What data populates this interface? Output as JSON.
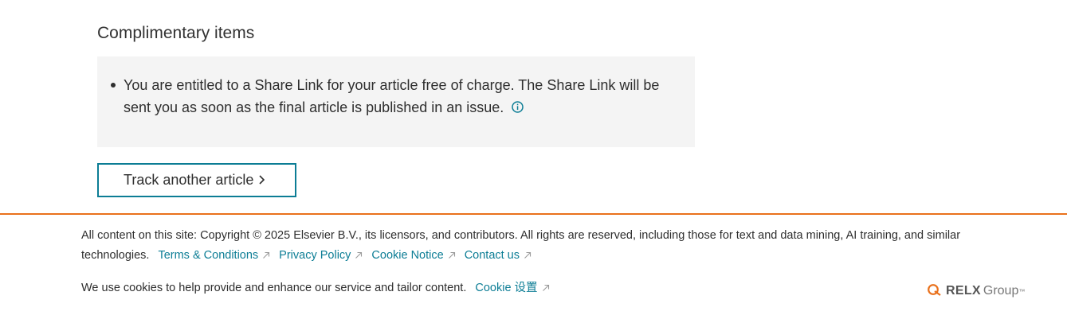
{
  "complimentary": {
    "title": "Complimentary items",
    "item_text": "You are entitled to a Share Link for your article free of charge. The Share Link will be sent you as soon as the final article is published in an issue."
  },
  "track_button": {
    "label": "Track another article"
  },
  "footer": {
    "copyright": "All content on this site: Copyright © 2025 Elsevier B.V., its licensors, and contributors. All rights are reserved, including those for text and data mining, AI training, and similar technologies.",
    "links": {
      "terms": "Terms & Conditions",
      "privacy": "Privacy Policy",
      "cookie_notice": "Cookie Notice",
      "contact": "Contact us"
    },
    "cookies_text": "We use cookies to help provide and enhance our service and tailor content.",
    "cookie_settings": "Cookie 设置",
    "logo": {
      "word": "RELX",
      "group": "Group",
      "tm": "™"
    }
  },
  "colors": {
    "accent": "#0c7d95",
    "divider": "#e9711c",
    "box_bg": "#f4f4f4"
  },
  "icons": [
    "info-icon",
    "chevron-right-icon",
    "external-link-icon",
    "relx-logo-icon"
  ]
}
